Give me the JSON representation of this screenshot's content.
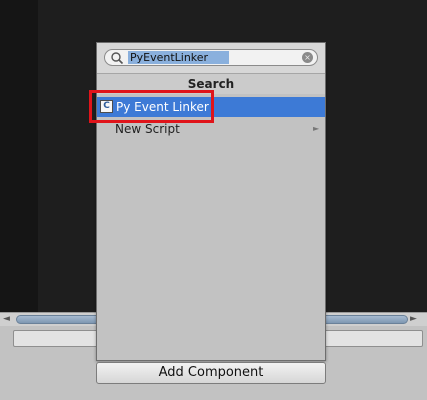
{
  "search": {
    "value": "PyEventLinker",
    "clear_icon": "×"
  },
  "popup": {
    "header": "Search",
    "result_item": {
      "label": "Py Event Linker",
      "icon_glyph": "C"
    },
    "new_script": {
      "label": "New Script",
      "arrow": "►"
    }
  },
  "inspector": {
    "scroll_left": "◄",
    "scroll_right": "►"
  },
  "add_component": {
    "label": "Add Component"
  },
  "colors": {
    "selection": "#3d7ad6",
    "highlight_box": "#e0141a"
  }
}
